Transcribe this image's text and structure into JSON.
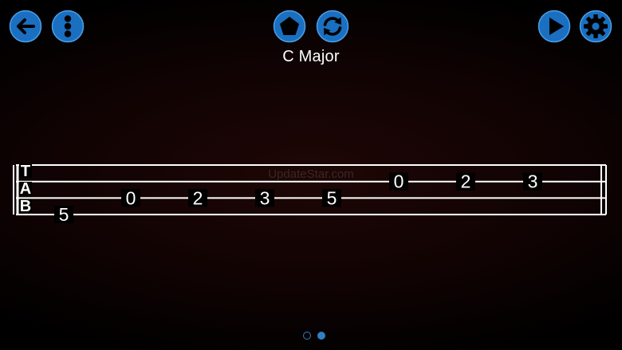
{
  "header": {
    "title": "C Major"
  },
  "icons": {
    "back": "arrow-left-icon",
    "menu": "vertical-dots-icon",
    "scale": "pentagon-icon",
    "reload": "refresh-icon",
    "play": "play-icon",
    "settings": "gear-icon"
  },
  "colors": {
    "accent": "#1a6fc1",
    "icon_stroke": "#4a9ee6",
    "staff": "#ffffff",
    "background": "#000000"
  },
  "watermark": "UpdateStar.com",
  "tab": {
    "clef": [
      "T",
      "A",
      "B"
    ],
    "string_count": 4,
    "notes": [
      {
        "string": 4,
        "fret": "5"
      },
      {
        "string": 3,
        "fret": "0"
      },
      {
        "string": 3,
        "fret": "2"
      },
      {
        "string": 3,
        "fret": "3"
      },
      {
        "string": 3,
        "fret": "5"
      },
      {
        "string": 2,
        "fret": "0"
      },
      {
        "string": 2,
        "fret": "2"
      },
      {
        "string": 2,
        "fret": "3"
      }
    ]
  },
  "pagination": {
    "total": 2,
    "current": 2
  }
}
